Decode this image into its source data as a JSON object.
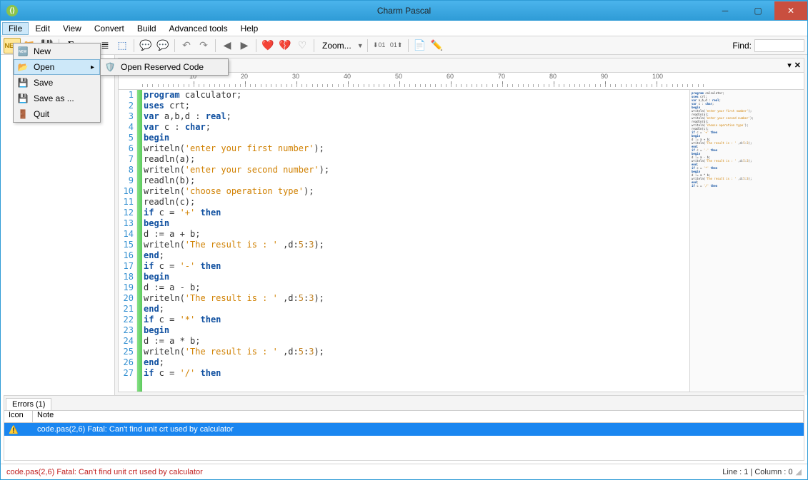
{
  "title": "Charm Pascal",
  "menubar": [
    "File",
    "Edit",
    "View",
    "Convert",
    "Build",
    "Advanced tools",
    "Help"
  ],
  "file_menu": {
    "items": [
      {
        "label": "New",
        "icon": "new"
      },
      {
        "label": "Open",
        "icon": "open",
        "has_sub": true,
        "hover": true
      },
      {
        "label": "Save",
        "icon": "save"
      },
      {
        "label": "Save as ...",
        "icon": "saveas"
      },
      {
        "label": "Quit",
        "icon": "quit"
      }
    ],
    "submenu": [
      {
        "label": "Open Reserved Code",
        "icon": "reserved"
      }
    ]
  },
  "toolbar": {
    "zoom": "Zoom...",
    "find_label": "Find:",
    "find_value": ""
  },
  "ruler_marks": [
    10,
    20,
    30,
    40,
    50,
    60,
    70,
    80,
    90,
    100
  ],
  "code_lines": [
    {
      "n": 1,
      "t": [
        {
          "c": "kw",
          "s": "program"
        },
        {
          "c": "ident",
          "s": " calculator;"
        }
      ]
    },
    {
      "n": 2,
      "t": [
        {
          "c": "kw",
          "s": "uses"
        },
        {
          "c": "ident",
          "s": " crt;"
        }
      ]
    },
    {
      "n": 3,
      "t": [
        {
          "c": "kw",
          "s": "var"
        },
        {
          "c": "ident",
          "s": " a,b,d : "
        },
        {
          "c": "kw",
          "s": "real"
        },
        {
          "c": "ident",
          "s": ";"
        }
      ]
    },
    {
      "n": 4,
      "t": [
        {
          "c": "kw",
          "s": "var"
        },
        {
          "c": "ident",
          "s": " c : "
        },
        {
          "c": "kw",
          "s": "char"
        },
        {
          "c": "ident",
          "s": ";"
        }
      ]
    },
    {
      "n": 5,
      "t": [
        {
          "c": "kw",
          "s": "begin"
        }
      ]
    },
    {
      "n": 6,
      "t": [
        {
          "c": "ident",
          "s": "writeln("
        },
        {
          "c": "str",
          "s": "'enter your first number'"
        },
        {
          "c": "ident",
          "s": ");"
        }
      ]
    },
    {
      "n": 7,
      "t": [
        {
          "c": "ident",
          "s": "readln(a);"
        }
      ]
    },
    {
      "n": 8,
      "t": [
        {
          "c": "ident",
          "s": "writeln("
        },
        {
          "c": "str",
          "s": "'enter your second number'"
        },
        {
          "c": "ident",
          "s": ");"
        }
      ]
    },
    {
      "n": 9,
      "t": [
        {
          "c": "ident",
          "s": "readln(b);"
        }
      ]
    },
    {
      "n": 10,
      "t": [
        {
          "c": "ident",
          "s": "writeln("
        },
        {
          "c": "str",
          "s": "'choose operation type'"
        },
        {
          "c": "ident",
          "s": ");"
        }
      ]
    },
    {
      "n": 11,
      "t": [
        {
          "c": "ident",
          "s": "readln(c);"
        }
      ]
    },
    {
      "n": 12,
      "t": [
        {
          "c": "kw",
          "s": "if"
        },
        {
          "c": "ident",
          "s": " c = "
        },
        {
          "c": "str",
          "s": "'+'"
        },
        {
          "c": "ident",
          "s": " "
        },
        {
          "c": "kw",
          "s": "then"
        }
      ]
    },
    {
      "n": 13,
      "t": [
        {
          "c": "kw",
          "s": "begin"
        }
      ]
    },
    {
      "n": 14,
      "t": [
        {
          "c": "ident",
          "s": "d := a + b;"
        }
      ]
    },
    {
      "n": 15,
      "t": [
        {
          "c": "ident",
          "s": "writeln("
        },
        {
          "c": "str",
          "s": "'The result is : '"
        },
        {
          "c": "ident",
          "s": " ,d:"
        },
        {
          "c": "op",
          "s": "5"
        },
        {
          "c": "ident",
          "s": ":"
        },
        {
          "c": "op",
          "s": "3"
        },
        {
          "c": "ident",
          "s": ");"
        }
      ]
    },
    {
      "n": 16,
      "t": [
        {
          "c": "kw",
          "s": "end"
        },
        {
          "c": "ident",
          "s": ";"
        }
      ]
    },
    {
      "n": 17,
      "t": [
        {
          "c": "kw",
          "s": "if"
        },
        {
          "c": "ident",
          "s": " c = "
        },
        {
          "c": "str",
          "s": "'-'"
        },
        {
          "c": "ident",
          "s": " "
        },
        {
          "c": "kw",
          "s": "then"
        }
      ]
    },
    {
      "n": 18,
      "t": [
        {
          "c": "kw",
          "s": "begin"
        }
      ]
    },
    {
      "n": 19,
      "t": [
        {
          "c": "ident",
          "s": "d := a - b;"
        }
      ]
    },
    {
      "n": 20,
      "t": [
        {
          "c": "ident",
          "s": "writeln("
        },
        {
          "c": "str",
          "s": "'The result is : '"
        },
        {
          "c": "ident",
          "s": " ,d:"
        },
        {
          "c": "op",
          "s": "5"
        },
        {
          "c": "ident",
          "s": ":"
        },
        {
          "c": "op",
          "s": "3"
        },
        {
          "c": "ident",
          "s": ");"
        }
      ]
    },
    {
      "n": 21,
      "t": [
        {
          "c": "kw",
          "s": "end"
        },
        {
          "c": "ident",
          "s": ";"
        }
      ]
    },
    {
      "n": 22,
      "t": [
        {
          "c": "kw",
          "s": "if"
        },
        {
          "c": "ident",
          "s": " c = "
        },
        {
          "c": "str",
          "s": "'*'"
        },
        {
          "c": "ident",
          "s": " "
        },
        {
          "c": "kw",
          "s": "then"
        }
      ]
    },
    {
      "n": 23,
      "t": [
        {
          "c": "kw",
          "s": "begin"
        }
      ]
    },
    {
      "n": 24,
      "t": [
        {
          "c": "ident",
          "s": "d := a * b;"
        }
      ]
    },
    {
      "n": 25,
      "t": [
        {
          "c": "ident",
          "s": "writeln("
        },
        {
          "c": "str",
          "s": "'The result is : '"
        },
        {
          "c": "ident",
          "s": " ,d:"
        },
        {
          "c": "op",
          "s": "5"
        },
        {
          "c": "ident",
          "s": ":"
        },
        {
          "c": "op",
          "s": "3"
        },
        {
          "c": "ident",
          "s": ");"
        }
      ]
    },
    {
      "n": 26,
      "t": [
        {
          "c": "kw",
          "s": "end"
        },
        {
          "c": "ident",
          "s": ";"
        }
      ]
    },
    {
      "n": 27,
      "t": [
        {
          "c": "kw",
          "s": "if"
        },
        {
          "c": "ident",
          "s": " c = "
        },
        {
          "c": "str",
          "s": "'/'"
        },
        {
          "c": "ident",
          "s": " "
        },
        {
          "c": "kw",
          "s": "then"
        }
      ]
    }
  ],
  "errors": {
    "tab": "Errors (1)",
    "header_icon": "Icon",
    "header_note": "Note",
    "rows": [
      {
        "note": "code.pas(2,6) Fatal: Can't find unit crt used by calculator"
      }
    ]
  },
  "status": {
    "error": "code.pas(2,6) Fatal: Can't find unit crt used by calculator",
    "position": "Line : 1 | Column : 0"
  }
}
